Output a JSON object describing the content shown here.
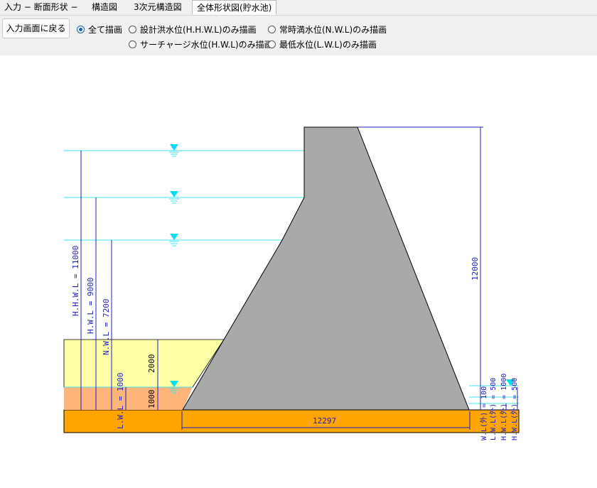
{
  "tabs": [
    {
      "label": "入力 − 断面形状 −"
    },
    {
      "label": "構造図"
    },
    {
      "label": "3次元構造図"
    },
    {
      "label": "全体形状図(貯水池)"
    }
  ],
  "toolbar": {
    "back_button": "入力画面に戻る",
    "radios": [
      {
        "label": "全て描画",
        "checked": true
      },
      {
        "label": "設計洪水位(H.H.W.L)のみ描画",
        "checked": false
      },
      {
        "label": "常時満水位(N.W.L)のみ描画",
        "checked": false
      },
      {
        "label": "サーチャージ水位(H.W.L)のみ描画",
        "checked": false
      },
      {
        "label": "最低水位(L.W.L)のみ描画",
        "checked": false
      }
    ]
  },
  "drawing": {
    "water_levels": [
      {
        "label": "H.H.W.L = 11000"
      },
      {
        "label": "H.W.L = 9000"
      },
      {
        "label": "N.W.L = 7200"
      },
      {
        "label": "L.W.L = 1000"
      }
    ],
    "dims": {
      "dam_height": "12000",
      "base_width": "12297",
      "sediment_upper": "2000",
      "sediment_lower": "1000"
    },
    "outer_labels": [
      "W.L(外) = 100",
      "L.W.L(外) = 500",
      "H.W.L(外) = 1000",
      "H.W.L(外) = 500"
    ],
    "colors": {
      "dam": "#a9a9a9",
      "water_line": "#40e0f0",
      "dim_line": "#2020c0",
      "sediment_light": "#ffffa8",
      "sediment_mid": "#ffb47a",
      "foundation": "#ffa500"
    }
  }
}
